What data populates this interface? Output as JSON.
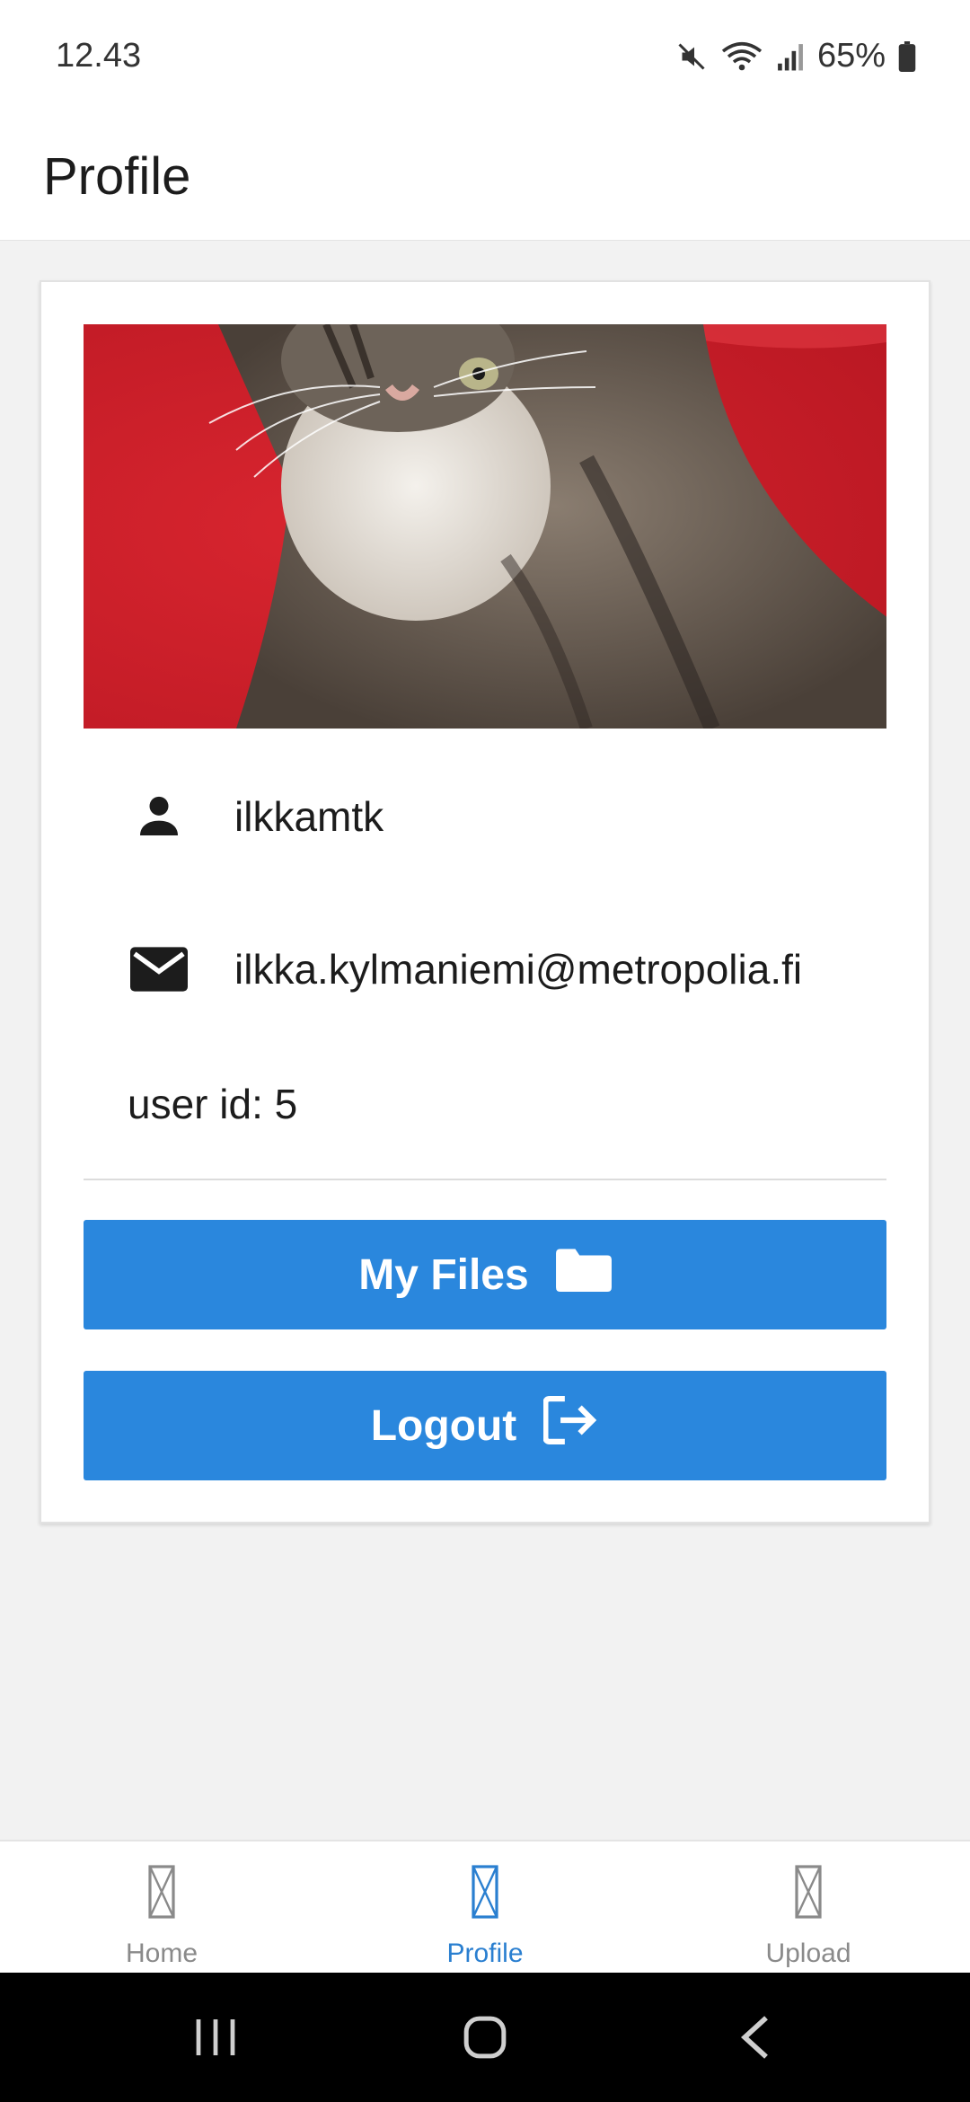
{
  "status_bar": {
    "time": "12.43",
    "battery": "65%",
    "icons": [
      "mute-icon",
      "wifi-icon",
      "signal-icon",
      "battery-icon"
    ]
  },
  "header": {
    "title": "Profile"
  },
  "profile": {
    "image_subject": "kitten-photo",
    "username": "ilkkamtk",
    "email": "ilkka.kylmaniemi@metropolia.fi",
    "user_id_text": "user id: 5"
  },
  "buttons": {
    "my_files": "My Files",
    "logout": "Logout"
  },
  "tabs": [
    {
      "label": "Home",
      "active": false
    },
    {
      "label": "Profile",
      "active": true
    },
    {
      "label": "Upload",
      "active": false
    }
  ],
  "colors": {
    "primary": "#2a87dd",
    "active_tab": "#2a7fd0",
    "inactive_tab": "#8a8a8a",
    "background": "#f2f2f2"
  }
}
